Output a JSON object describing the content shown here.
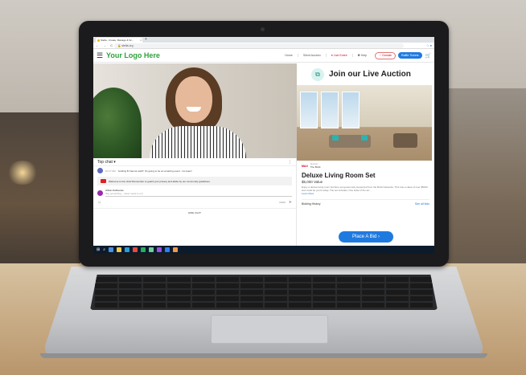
{
  "browser": {
    "tab_title": "Stella - Create, Manage & Sc...",
    "tab_close": "×",
    "tab_new": "+",
    "nav_icons": "← → C",
    "url": "🔒 stella.org",
    "addr_right": "☆ ●"
  },
  "header": {
    "menu_icon": "☰",
    "logo": "Your Logo Here",
    "nav": [
      "Home",
      "Silent Auction",
      "● Live Event",
      "❷ Help"
    ],
    "donate": "♡ Donate",
    "raffle": "Raffle Tickets",
    "cart_icon": "🛒"
  },
  "chat": {
    "title": "Top chat ▾",
    "menu": "⋮",
    "message_ts": "10:17 AM",
    "message_text": "Golding B    Cannot wait!!! It's going to be an amazing event - Go team!",
    "notice": "Welcome to live chat! Remember to guard your privacy and abide by our community guidelines.",
    "input_name": "Gillian Deliberate",
    "input_placeholder": "Say something... (slow mode is on)",
    "emoji": "☺",
    "count": "0/200",
    "send": "➤",
    "hide": "HIDE CHAT"
  },
  "auction": {
    "icon": "⧉",
    "title": "Join our Live Auction",
    "sponsor_logo": "MAX",
    "sponsor_label": "Sponsor",
    "sponsor_name": "The Brick",
    "item_title": "Deluxe Living Room Set",
    "item_value": "$5,000 Value",
    "item_desc": "Enjoy a deluxe living room furniture set generously supported from the Brick Networks. This has a value of over $5000 and could be yours today. The set includes: One state of the art...",
    "learn_more": "Learn More",
    "bidding_history": "Bidding History",
    "see_all": "See all bids",
    "bid_button": "Place A Bid ›"
  },
  "taskbar": {
    "start": "⊞",
    "search": "⌕",
    "icons": [
      "#4a90e2",
      "#f2c94c",
      "#2d9cdb",
      "#e74c3c",
      "#27ae60",
      "#6fcf97",
      "#9b51e0",
      "#2f80ed",
      "#f2994a"
    ]
  }
}
